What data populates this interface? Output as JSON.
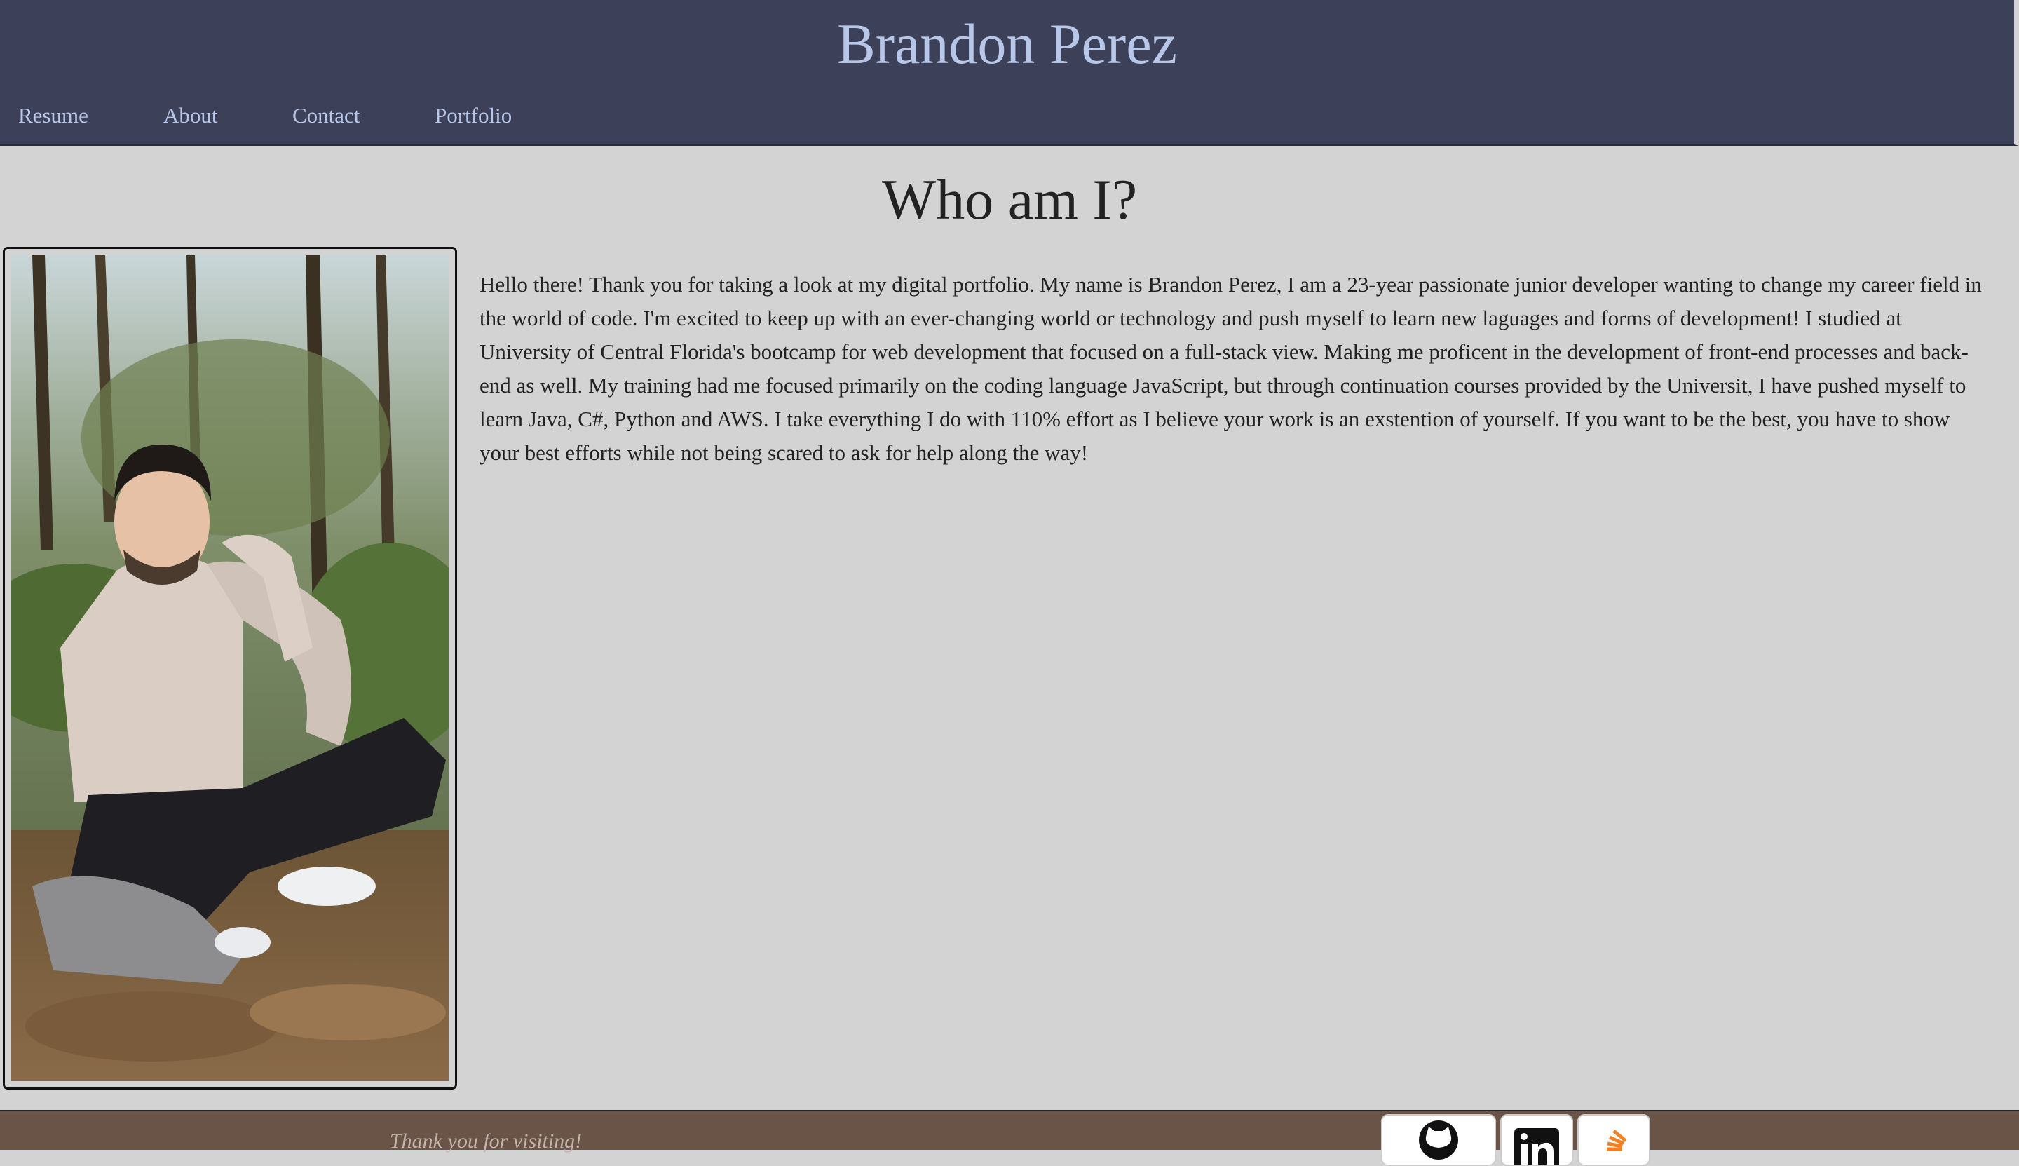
{
  "header": {
    "title": "Brandon Perez",
    "nav": [
      {
        "label": "Resume"
      },
      {
        "label": "About"
      },
      {
        "label": "Contact"
      },
      {
        "label": "Portfolio"
      }
    ]
  },
  "main": {
    "heading": "Who am I?",
    "photo_alt": "Photo of Brandon Perez sitting in the woods",
    "bio": "Hello there! Thank you for taking a look at my digital portfolio. My name is Brandon Perez, I am a 23-year passionate junior developer wanting to change my career field in the world of code. I'm excited to keep up with an ever-changing world or technology and push myself to learn new laguages and forms of development! I studied at University of Central Florida's bootcamp for web development that focused on a full-stack view. Making me proficent in the development of front-end processes and back-end as well. My training had me focused primarily on the coding language JavaScript, but through continuation courses provided by the Universit, I have pushed myself to learn Java, C#, Python and AWS. I take everything I do with 110% effort as I believe your work is an exstention of yourself. If you want to be the best, you have to show your best efforts while not being scared to ask for help along the way!"
  },
  "footer": {
    "text": "Thank you for visiting!",
    "social": [
      {
        "icon": "github-icon"
      },
      {
        "icon": "linkedin-icon"
      },
      {
        "icon": "stackoverflow-icon"
      }
    ]
  },
  "colors": {
    "header_bg": "#3c4059",
    "header_text": "#b8c6e8",
    "page_bg": "#d3d3d3",
    "footer_bg": "#6a5447"
  }
}
